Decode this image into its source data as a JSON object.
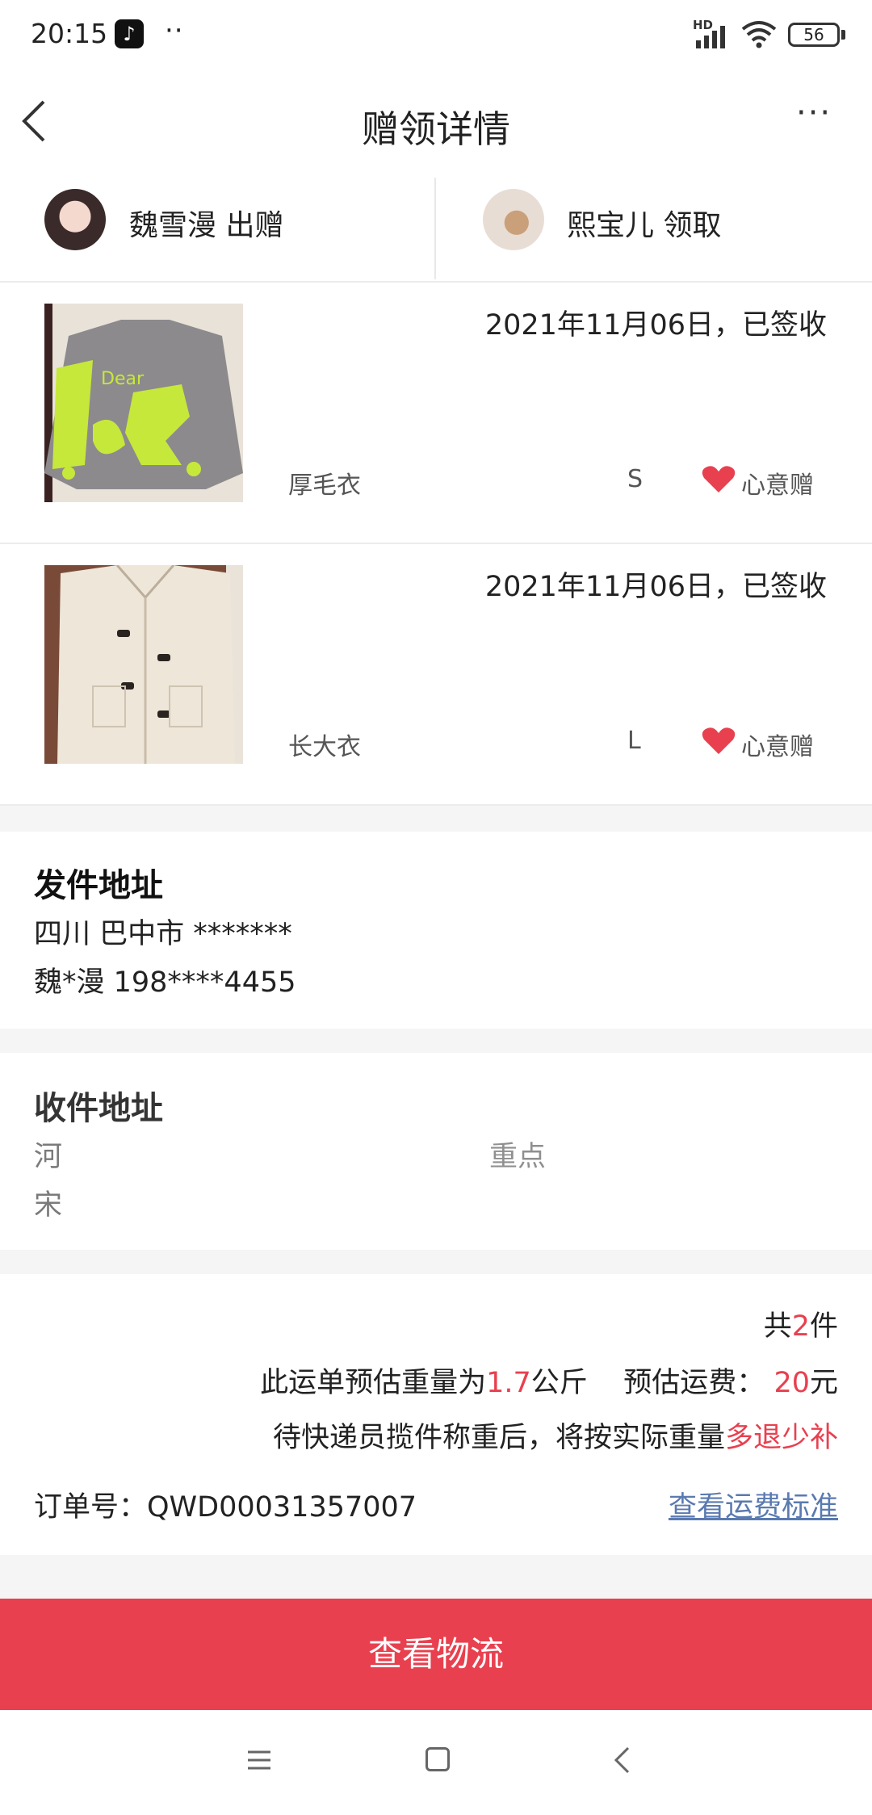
{
  "status_bar": {
    "time": "20:15",
    "app_icon": "tiktok-icon",
    "more": "··",
    "network": "HD",
    "battery": "56"
  },
  "nav": {
    "title": "赠领详情",
    "back_icon": "chevron-left-icon",
    "more_icon": "more-horizontal-icon",
    "more_text": "···"
  },
  "participants": {
    "giver": "魏雪漫 出赠",
    "receiver": "熙宝儿 领取"
  },
  "items": [
    {
      "date_status": "2021年11月06日，已签收",
      "name": "厚毛衣",
      "size": "S",
      "tag": "心意赠"
    },
    {
      "date_status": "2021年11月06日，已签收",
      "name": "长大衣",
      "size": "L",
      "tag": "心意赠"
    }
  ],
  "sender_address": {
    "title": "发件地址",
    "region": "四川 巴中市 *******",
    "contact": "魏*漫 198****4455"
  },
  "receiver_address": {
    "title": "收件地址",
    "line1": "河",
    "line1_tail": "重点",
    "line2": "宋"
  },
  "summary": {
    "count_prefix": "共",
    "count": "2",
    "count_suffix": "件",
    "weight_prefix": "此运单预估重量为",
    "weight": "1.7",
    "weight_unit": "公斤",
    "fee_prefix": "预估运费：",
    "fee": "20",
    "fee_unit": "元",
    "note_prefix": "待快递员揽件称重后，将按实际重量",
    "note_highlight": "多退少补",
    "order_label": "订单号：QWD00031357007",
    "fee_link": "查看运费标准"
  },
  "button": {
    "logistics": "查看物流"
  },
  "colors": {
    "accent": "#e8404f",
    "link": "#5a7ab0",
    "divider": "#ececec",
    "section_bg": "#f5f5f5"
  }
}
